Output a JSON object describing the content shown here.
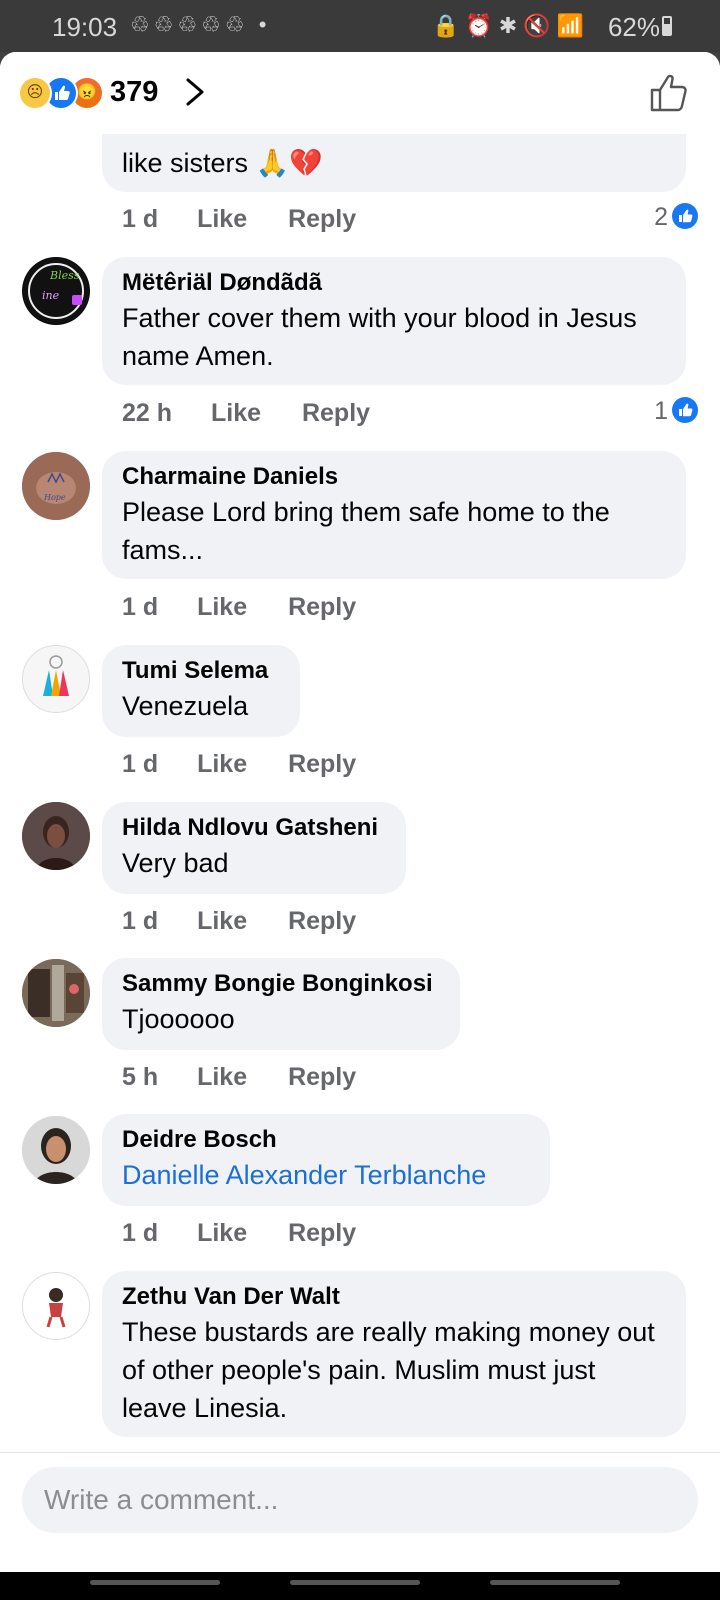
{
  "status_bar": {
    "time": "19:03",
    "notification_icons": "♲♲♲♲♲ •",
    "right_icons": "🔒⏰✱🔇📶",
    "battery": "62%"
  },
  "header": {
    "reaction_count": "379",
    "reactions": [
      "sad-icon",
      "like-icon",
      "angry-icon"
    ]
  },
  "comments": [
    {
      "author": "",
      "text": "Aneesha was our neighbour we Grew up like sisters 🙏💔",
      "visible_text": "like sisters 🙏💔",
      "time": "1 d",
      "like_label": "Like",
      "reply_label": "Reply",
      "like_count": "2"
    },
    {
      "author": "Mëtêriäl Døndãdã",
      "text": "Father  cover them with your blood in Jesus name Amen.",
      "time": "22 h",
      "like_label": "Like",
      "reply_label": "Reply",
      "like_count": "1"
    },
    {
      "author": "Charmaine Daniels",
      "text": "Please Lord  bring them safe home to the fams...",
      "time": "1 d",
      "like_label": "Like",
      "reply_label": "Reply"
    },
    {
      "author": "Tumi Selema",
      "text": "Venezuela",
      "time": "1 d",
      "like_label": "Like",
      "reply_label": "Reply"
    },
    {
      "author": "Hilda Ndlovu Gatsheni",
      "text": "Very bad",
      "time": "1 d",
      "like_label": "Like",
      "reply_label": "Reply"
    },
    {
      "author": "Sammy Bongie Bonginkosi",
      "text": "Tjoooooo",
      "time": "5 h",
      "like_label": "Like",
      "reply_label": "Reply"
    },
    {
      "author": "Deidre Bosch",
      "text": "Danielle Alexander Terblanche",
      "time": "1 d",
      "like_label": "Like",
      "reply_label": "Reply"
    },
    {
      "author": "Zethu Van Der Walt",
      "text": "These bustards are really making money out of other people's pain. Muslim must just leave Linesia."
    }
  ],
  "composer": {
    "placeholder": "Write a comment..."
  },
  "colors": {
    "accent": "#1877f2",
    "bubble": "#f0f2f5",
    "meta_text": "#65676b",
    "mention": "#1b6fd6"
  }
}
